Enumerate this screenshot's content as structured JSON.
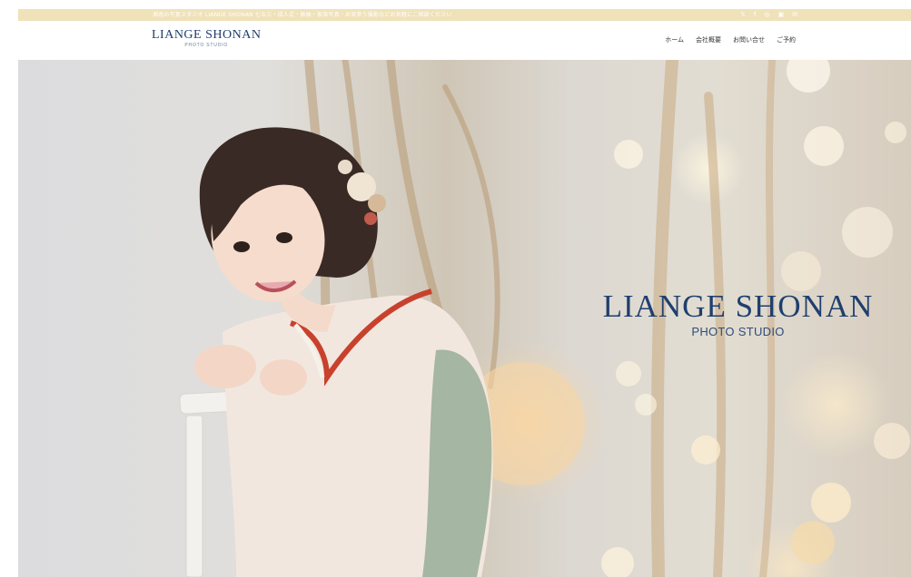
{
  "topbar": {
    "notice": "湘南の写真スタジオ LIANGE SHONAN 七五三・成人式・振袖・家族写真・お宮参り撮影などお気軽にご相談ください",
    "social_icons": [
      "twitter-icon",
      "facebook-icon",
      "instagram-icon",
      "line-icon",
      "mail-icon"
    ]
  },
  "header": {
    "logo_main": "LIANGE SHONAN",
    "logo_sub": "PHOTO STUDIO"
  },
  "nav": {
    "items": [
      {
        "label": "ホーム"
      },
      {
        "label": "会社概要"
      },
      {
        "label": "お問い合せ"
      },
      {
        "label": "ご予約"
      }
    ]
  },
  "hero": {
    "title": "LIANGE SHONAN",
    "subtitle": "PHOTO STUDIO",
    "image_alt": "Woman in furisode kimono smiling, leaning on a white chair",
    "colors": {
      "brand_navy": "#1f3f6e",
      "topbar_gold": "#efe2b9",
      "kimono_red": "#c8412d"
    }
  }
}
